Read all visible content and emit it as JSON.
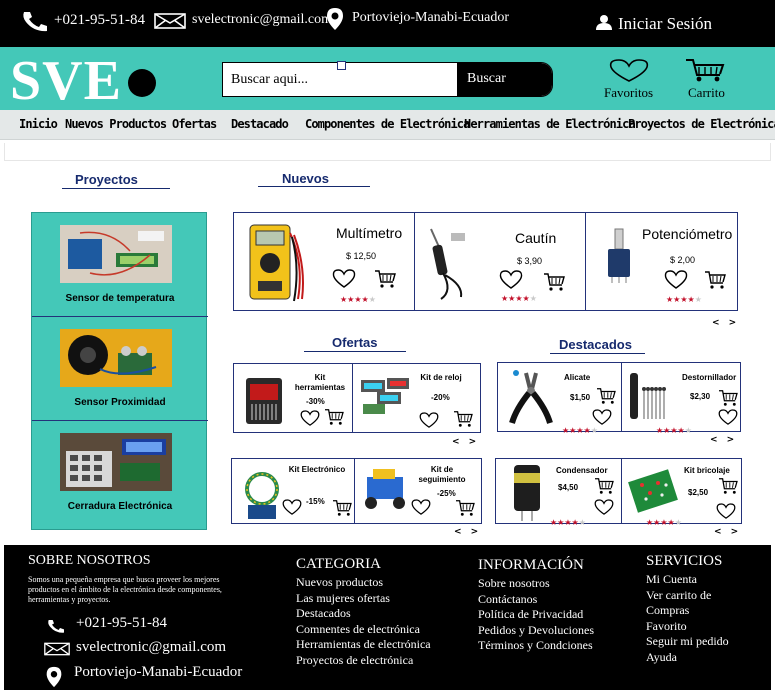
{
  "topbar": {
    "phone": "+021-95-51-84",
    "email": "svelectronic@gmail.com",
    "location": "Portoviejo-Manabi-Ecuador",
    "login": "Iniciar Sesión"
  },
  "brand": {
    "logo": "SVE",
    "accent": "#44c8b8"
  },
  "search": {
    "placeholder": "Buscar aqui...",
    "button": "Buscar"
  },
  "header_actions": {
    "favorites": "Favoritos",
    "cart": "Carrito"
  },
  "nav": [
    "Inicio",
    "Nuevos Productos",
    "Ofertas",
    "Destacado",
    "Componentes de Electrónica",
    "Herramientas de Electrónica",
    "Proyectos de Electrónica"
  ],
  "sections": {
    "projects": "Proyectos",
    "new": "Nuevos",
    "offers": "Ofertas",
    "featured": "Destacados"
  },
  "projects": [
    {
      "label": "Sensor de temperatura"
    },
    {
      "label": "Sensor Proximidad"
    },
    {
      "label": "Cerradura Electrónica"
    }
  ],
  "new_products": [
    {
      "name": "Multímetro",
      "price": "$ 12,50",
      "rating": 4
    },
    {
      "name": "Cautín",
      "price": "$ 3,90",
      "rating": 4
    },
    {
      "name": "Potenciómetro",
      "price": "$ 2,00",
      "rating": 4
    }
  ],
  "offers": [
    {
      "name": "Kit herramientas",
      "discount": "-30%"
    },
    {
      "name": "Kit de reloj",
      "discount": "-20%"
    },
    {
      "name": "Kit Electrónico",
      "discount": "-15%"
    },
    {
      "name": "Kit de seguimiento",
      "discount": "-25%"
    }
  ],
  "featured": [
    {
      "name": "Alicate",
      "price": "$1,50",
      "rating": 4
    },
    {
      "name": "Destornillador",
      "price": "$2,30",
      "rating": 4
    },
    {
      "name": "Condensador",
      "price": "$4,50",
      "rating": 4
    },
    {
      "name": "Kit bricolaje",
      "price": "$2,50",
      "rating": 4
    }
  ],
  "pager": {
    "arrows": "< >"
  },
  "footer": {
    "about_title": "SOBRE NOSOTROS",
    "about_text": "Somos una pequeña empresa que busca proveer los mejores productos en el ámbito de la electrónica desde componentes, herramientas y proyectos.",
    "phone": "+021-95-51-84",
    "email": "svelectronic@gmail.com",
    "location": "Portoviejo-Manabi-Ecuador",
    "categoria_title": "CATEGORIA",
    "categoria": [
      "Nuevos productos",
      "Las mujeres ofertas",
      "Destacados",
      "Comnentes de electrónica",
      "Herramientas de electrónica",
      "Proyectos de electrónica"
    ],
    "info_title": "INFORMACIÓN",
    "info": [
      "Sobre nosotros",
      "Contáctanos",
      "Política de Privacidad",
      "Pedidos y Devoluciones",
      "Términos y Condciones"
    ],
    "services_title": "SERVICIOS",
    "services": [
      "Mi Cuenta",
      "Ver carrito de Compras",
      "Favorito",
      "Seguir mi pedido",
      "Ayuda"
    ]
  }
}
